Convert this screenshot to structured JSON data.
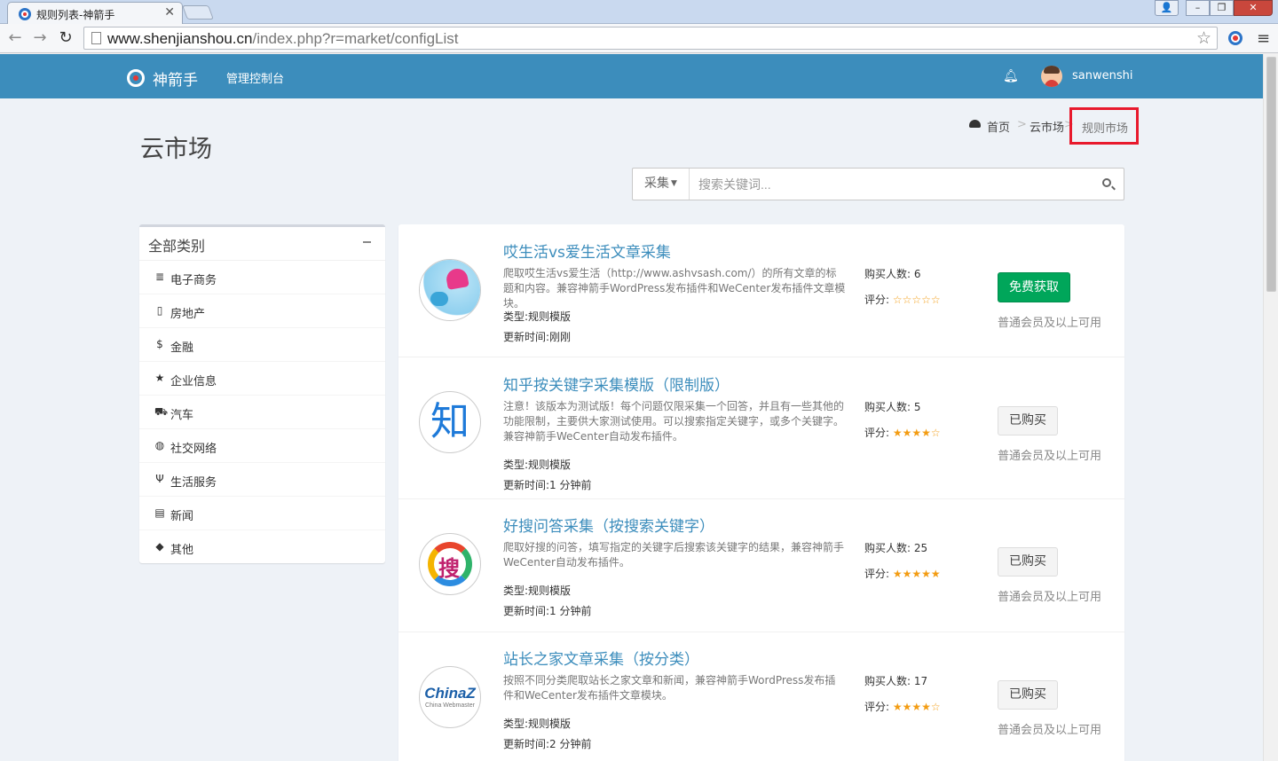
{
  "browser": {
    "tab_title": "规则列表-神箭手",
    "url_host": "www.shenjianshou.cn",
    "url_path": "/index.php?r=market/configList"
  },
  "topbar": {
    "logo_text": "神箭手",
    "nav_console": "管理控制台",
    "username": "sanwenshi"
  },
  "page": {
    "title": "云市场"
  },
  "breadcrumb": {
    "home": "首页",
    "market": "云市场",
    "current": "规则市场",
    "separator": ">"
  },
  "search": {
    "category": "采集",
    "placeholder": "搜索关键词..."
  },
  "sidebar": {
    "title": "全部类别",
    "items": [
      {
        "label": "电子商务",
        "icon": "database-icon"
      },
      {
        "label": "房地产",
        "icon": "building-icon"
      },
      {
        "label": "金融",
        "icon": "dollar-icon"
      },
      {
        "label": "企业信息",
        "icon": "star-icon"
      },
      {
        "label": "汽车",
        "icon": "car-icon"
      },
      {
        "label": "社交网络",
        "icon": "wechat-icon"
      },
      {
        "label": "生活服务",
        "icon": "cutlery-icon"
      },
      {
        "label": "新闻",
        "icon": "newspaper-icon"
      },
      {
        "label": "其他",
        "icon": "tags-icon"
      }
    ]
  },
  "labels": {
    "buyers": "购买人数:",
    "rating": "评分:",
    "type": "类型:",
    "updated": "更新时间:"
  },
  "products": [
    {
      "name": "哎生活vs爱生活文章采集",
      "desc": "爬取哎生活vs爱生活（http://www.ashvsash.com/）的所有文章的标题和内容。兼容神箭手WordPress发布插件和WeCenter发布插件文章模块。",
      "type": "规则模版",
      "updated": "刚刚",
      "buyers": "6",
      "rating": 0,
      "stars": "☆☆☆☆☆",
      "action": "免费获取",
      "note": "普通会员及以上可用"
    },
    {
      "name": "知乎按关键字采集模版（限制版）",
      "desc": "注意！该版本为测试版！每个问题仅限采集一个回答，并且有一些其他的功能限制，主要供大家测试使用。可以搜索指定关键字，或多个关键字。兼容神箭手WeCenter自动发布插件。",
      "type": "规则模版",
      "updated": "1 分钟前",
      "buyers": "5",
      "rating": 4,
      "stars": "★★★★☆",
      "action": "已购买",
      "note": "普通会员及以上可用"
    },
    {
      "name": "好搜问答采集（按搜索关键字）",
      "desc": "爬取好搜的问答，填写指定的关键字后搜索该关键字的结果，兼容神箭手WeCenter自动发布插件。",
      "type": "规则模版",
      "updated": "1 分钟前",
      "buyers": "25",
      "rating": 4.5,
      "stars": "★★★★★",
      "action": "已购买",
      "note": "普通会员及以上可用"
    },
    {
      "name": "站长之家文章采集（按分类）",
      "desc": "按照不同分类爬取站长之家文章和新闻，兼容神箭手WordPress发布插件和WeCenter发布插件文章模块。",
      "type": "规则模版",
      "updated": "2 分钟前",
      "buyers": "17",
      "rating": 4,
      "stars": "★★★★☆",
      "action": "已购买",
      "note": "普通会员及以上可用"
    }
  ],
  "thumb_text": {
    "zhihu": "知",
    "haosou": "搜",
    "chinaz": "ChinaZ",
    "chinaz_sub": "China Webmaster"
  },
  "colors": {
    "primary": "#3c8dbc",
    "success": "#00a65a",
    "star": "#f39c12",
    "highlight_border": "#e8192c"
  }
}
